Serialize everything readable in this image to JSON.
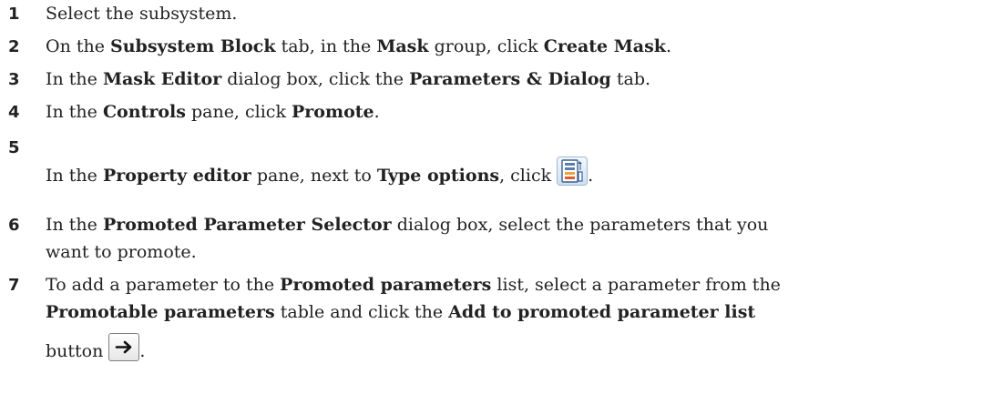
{
  "steps": [
    {
      "num": "1",
      "parts": [
        "Select the subsystem."
      ]
    },
    {
      "num": "2",
      "parts": [
        "On the ",
        "Subsystem Block",
        " tab, in the ",
        "Mask",
        " group, click ",
        "Create Mask",
        "."
      ]
    },
    {
      "num": "3",
      "parts": [
        "In the ",
        "Mask Editor",
        " dialog box, click the ",
        "Parameters & Dialog",
        " tab."
      ]
    },
    {
      "num": "4",
      "parts": [
        "In the ",
        "Controls",
        " pane, click ",
        "Promote",
        "."
      ]
    },
    {
      "num": "5",
      "parts": [
        "In the ",
        "Property editor",
        " pane, next to ",
        "Type options",
        ", click ",
        "."
      ]
    },
    {
      "num": "6",
      "parts": [
        "In the ",
        "Promoted Parameter Selector",
        " dialog box, select the parameters that you",
        "want to promote."
      ]
    },
    {
      "num": "7",
      "parts": [
        "To add a parameter to the ",
        "Promoted parameters",
        " list, select a parameter from the",
        "Promotable parameters",
        " table and click the ",
        "Add to promoted parameter list",
        "button ",
        "."
      ]
    }
  ],
  "icons": {
    "type_options": "type-options-icon",
    "add_promoted": "right-arrow-icon"
  }
}
